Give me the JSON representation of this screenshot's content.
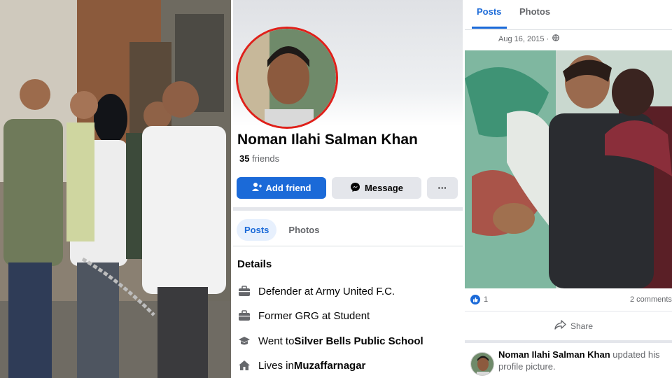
{
  "profile": {
    "name": "Noman Ilahi Salman Khan",
    "friends_count": "35",
    "friends_label": "friends",
    "add_friend_label": "Add friend",
    "message_label": "Message",
    "more_label": "···",
    "tabs": [
      {
        "label": "Posts"
      },
      {
        "label": "Photos"
      }
    ],
    "details_heading": "Details",
    "details": [
      {
        "icon": "briefcase-icon",
        "text": "Defender at Army United F.C.",
        "bold": ""
      },
      {
        "icon": "briefcase-icon",
        "text": "Former GRG at Student",
        "bold": ""
      },
      {
        "icon": "graduation-cap-icon",
        "text": "Went to ",
        "bold": "Silver Bells Public School"
      },
      {
        "icon": "home-icon",
        "text": "Lives in ",
        "bold": "Muzaffarnagar"
      }
    ]
  },
  "feed": {
    "tabs": [
      {
        "label": "Posts"
      },
      {
        "label": "Photos"
      }
    ],
    "post_date": "Aug 16, 2015 ·",
    "likes_count": "1",
    "comments_label": "2 comments",
    "share_label": "Share",
    "update_name": "Noman Ilahi Salman Khan",
    "update_text": " updated his profile picture."
  },
  "colors": {
    "facebook_blue": "#1b6ad8",
    "avatar_ring": "#e0201a",
    "button_grey": "#e4e6eb"
  }
}
